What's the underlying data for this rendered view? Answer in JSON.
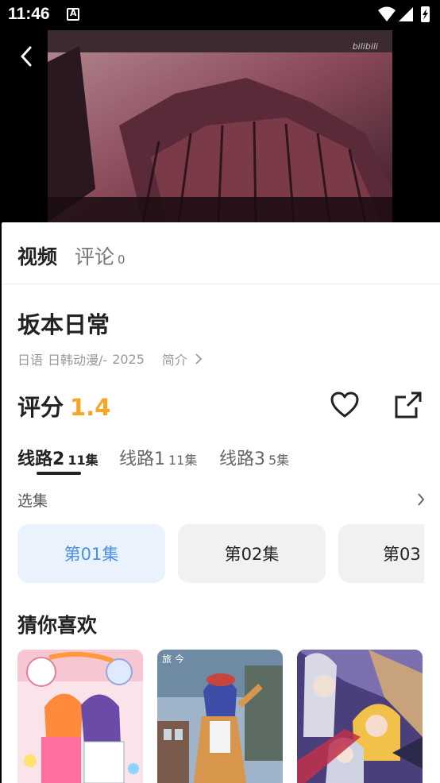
{
  "status_bar": {
    "time": "11:46"
  },
  "video": {
    "watermark": "bilibili"
  },
  "tabs": {
    "video_label": "视频",
    "comments_label": "评论",
    "comments_count": "0"
  },
  "anime": {
    "title": "坂本日常",
    "language": "日语",
    "category": "日韩动漫/-",
    "year": "2025",
    "intro_label": "简介"
  },
  "score": {
    "label": "评分",
    "value": "1.4"
  },
  "routes": [
    {
      "name": "线路2",
      "count": "11集",
      "active": true
    },
    {
      "name": "线路1",
      "count": "11集",
      "active": false
    },
    {
      "name": "线路3",
      "count": "5集",
      "active": false
    }
  ],
  "episodes": {
    "label": "选集",
    "items": [
      "第01集",
      "第02集",
      "第03"
    ]
  },
  "recommend": {
    "title": "猜你喜欢"
  },
  "colors": {
    "score": "#f5a623",
    "active_episode_text": "#4a90e2",
    "active_episode_bg": "#e9f2fd"
  },
  "icons": [
    "back-arrow-icon",
    "heart-icon",
    "share-icon",
    "chevron-right-icon"
  ]
}
